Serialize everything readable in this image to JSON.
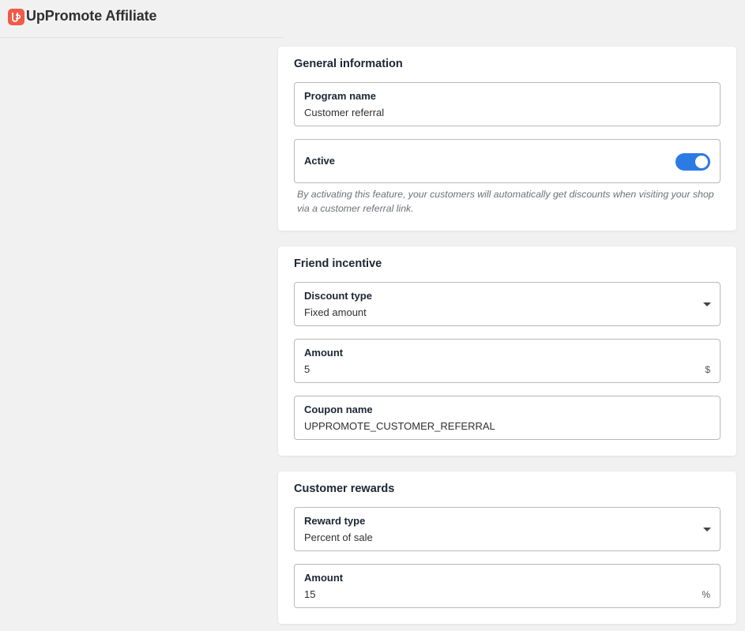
{
  "app": {
    "title": "UpPromote Affiliate",
    "logo_icon": "uppromote-logo-icon",
    "brand_color": "#ef5b45"
  },
  "general_information": {
    "title": "General information",
    "program_name": {
      "label": "Program name",
      "value": "Customer referral"
    },
    "active": {
      "label": "Active",
      "enabled": true,
      "toggle_color": "#2c7be5",
      "help_text": "By activating this feature, your customers will automatically get discounts when visiting your shop via a customer referral link."
    }
  },
  "friend_incentive": {
    "title": "Friend incentive",
    "discount_type": {
      "label": "Discount type",
      "value": "Fixed amount",
      "icon": "caret-down-icon"
    },
    "amount": {
      "label": "Amount",
      "value": "5",
      "suffix": "$"
    },
    "coupon_name": {
      "label": "Coupon name",
      "value": "UPPROMOTE_CUSTOMER_REFERRAL"
    }
  },
  "customer_rewards": {
    "title": "Customer rewards",
    "reward_type": {
      "label": "Reward type",
      "value": "Percent of sale",
      "icon": "caret-down-icon"
    },
    "amount": {
      "label": "Amount",
      "value": "15",
      "suffix": "%"
    }
  }
}
